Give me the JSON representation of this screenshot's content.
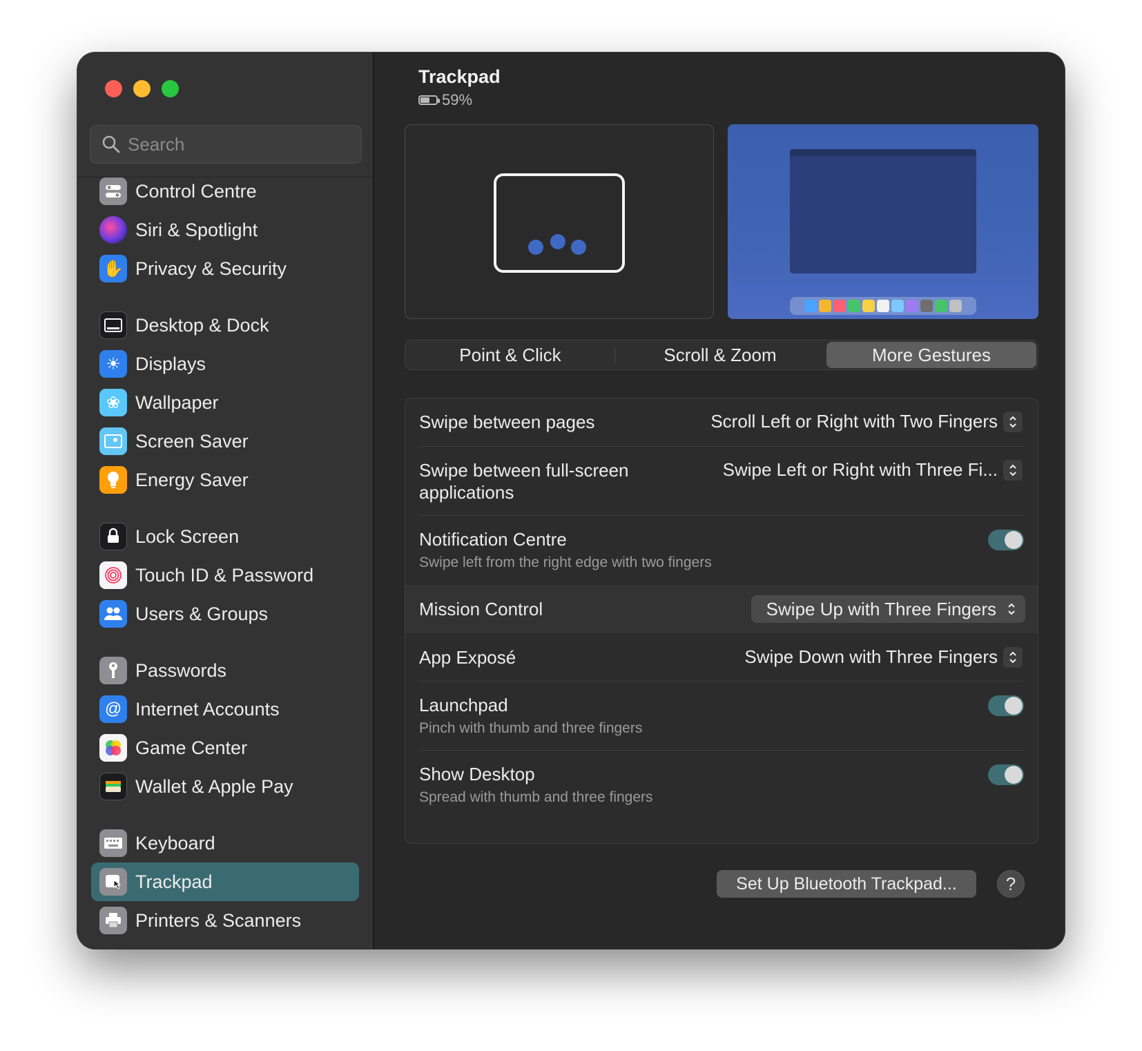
{
  "window": {
    "title": "Trackpad"
  },
  "device": {
    "battery_percent_label": "59%",
    "battery_level": 0.59
  },
  "search": {
    "placeholder": "Search"
  },
  "sidebar": {
    "items": [
      {
        "label": "Control Centre",
        "icon": "control-centre-icon",
        "color": "#8e8e93"
      },
      {
        "label": "Siri & Spotlight",
        "icon": "siri-icon",
        "color": "#5b3cc4"
      },
      {
        "label": "Privacy & Security",
        "icon": "hand-icon",
        "color": "#2f80ed"
      },
      {
        "label": "Desktop & Dock",
        "icon": "desktop-dock-icon",
        "color": "#1c1c1e"
      },
      {
        "label": "Displays",
        "icon": "sun-icon",
        "color": "#2f80ed"
      },
      {
        "label": "Wallpaper",
        "icon": "flower-icon",
        "color": "#5ac8fa"
      },
      {
        "label": "Screen Saver",
        "icon": "screen-saver-icon",
        "color": "#63c7f5"
      },
      {
        "label": "Energy Saver",
        "icon": "lightbulb-icon",
        "color": "#ff9f0a"
      },
      {
        "label": "Lock Screen",
        "icon": "lock-icon",
        "color": "#1c1c1e"
      },
      {
        "label": "Touch ID & Password",
        "icon": "fingerprint-icon",
        "color": "#f5f5f7"
      },
      {
        "label": "Users & Groups",
        "icon": "users-icon",
        "color": "#2f80ed"
      },
      {
        "label": "Passwords",
        "icon": "key-icon",
        "color": "#8e8e93"
      },
      {
        "label": "Internet Accounts",
        "icon": "at-icon",
        "color": "#2f80ed"
      },
      {
        "label": "Game Center",
        "icon": "game-center-icon",
        "color": "#f5f5f7"
      },
      {
        "label": "Wallet & Apple Pay",
        "icon": "wallet-icon",
        "color": "#1c1c1e"
      },
      {
        "label": "Keyboard",
        "icon": "keyboard-icon",
        "color": "#8e8e93"
      },
      {
        "label": "Trackpad",
        "icon": "trackpad-icon",
        "color": "#8e8e93",
        "selected": true
      },
      {
        "label": "Printers & Scanners",
        "icon": "printer-icon",
        "color": "#8e8e93"
      }
    ]
  },
  "tabs": [
    {
      "label": "Point & Click",
      "active": false
    },
    {
      "label": "Scroll & Zoom",
      "active": false
    },
    {
      "label": "More Gestures",
      "active": true
    }
  ],
  "settings": {
    "swipe_pages": {
      "title": "Swipe between pages",
      "value": "Scroll Left or Right with Two Fingers"
    },
    "swipe_fullscreen": {
      "title_line1": "Swipe between full-screen",
      "title_line2": "applications",
      "value": "Swipe Left or Right with Three Fi..."
    },
    "notification_centre": {
      "title": "Notification Centre",
      "subtitle": "Swipe left from the right edge with two fingers",
      "enabled": true
    },
    "mission_control": {
      "title": "Mission Control",
      "value": "Swipe Up with Three Fingers"
    },
    "app_expose": {
      "title": "App Exposé",
      "value": "Swipe Down with Three Fingers"
    },
    "launchpad": {
      "title": "Launchpad",
      "subtitle": "Pinch with thumb and three fingers",
      "enabled": true
    },
    "show_desktop": {
      "title": "Show Desktop",
      "subtitle": "Spread with thumb and three fingers",
      "enabled": true
    }
  },
  "footer": {
    "bluetooth_button": "Set Up Bluetooth Trackpad...",
    "help": "?"
  },
  "colors": {
    "accent": "#3b6b72",
    "toggle_on": "#3f6f74",
    "gesture_dot": "#3f69c4"
  }
}
